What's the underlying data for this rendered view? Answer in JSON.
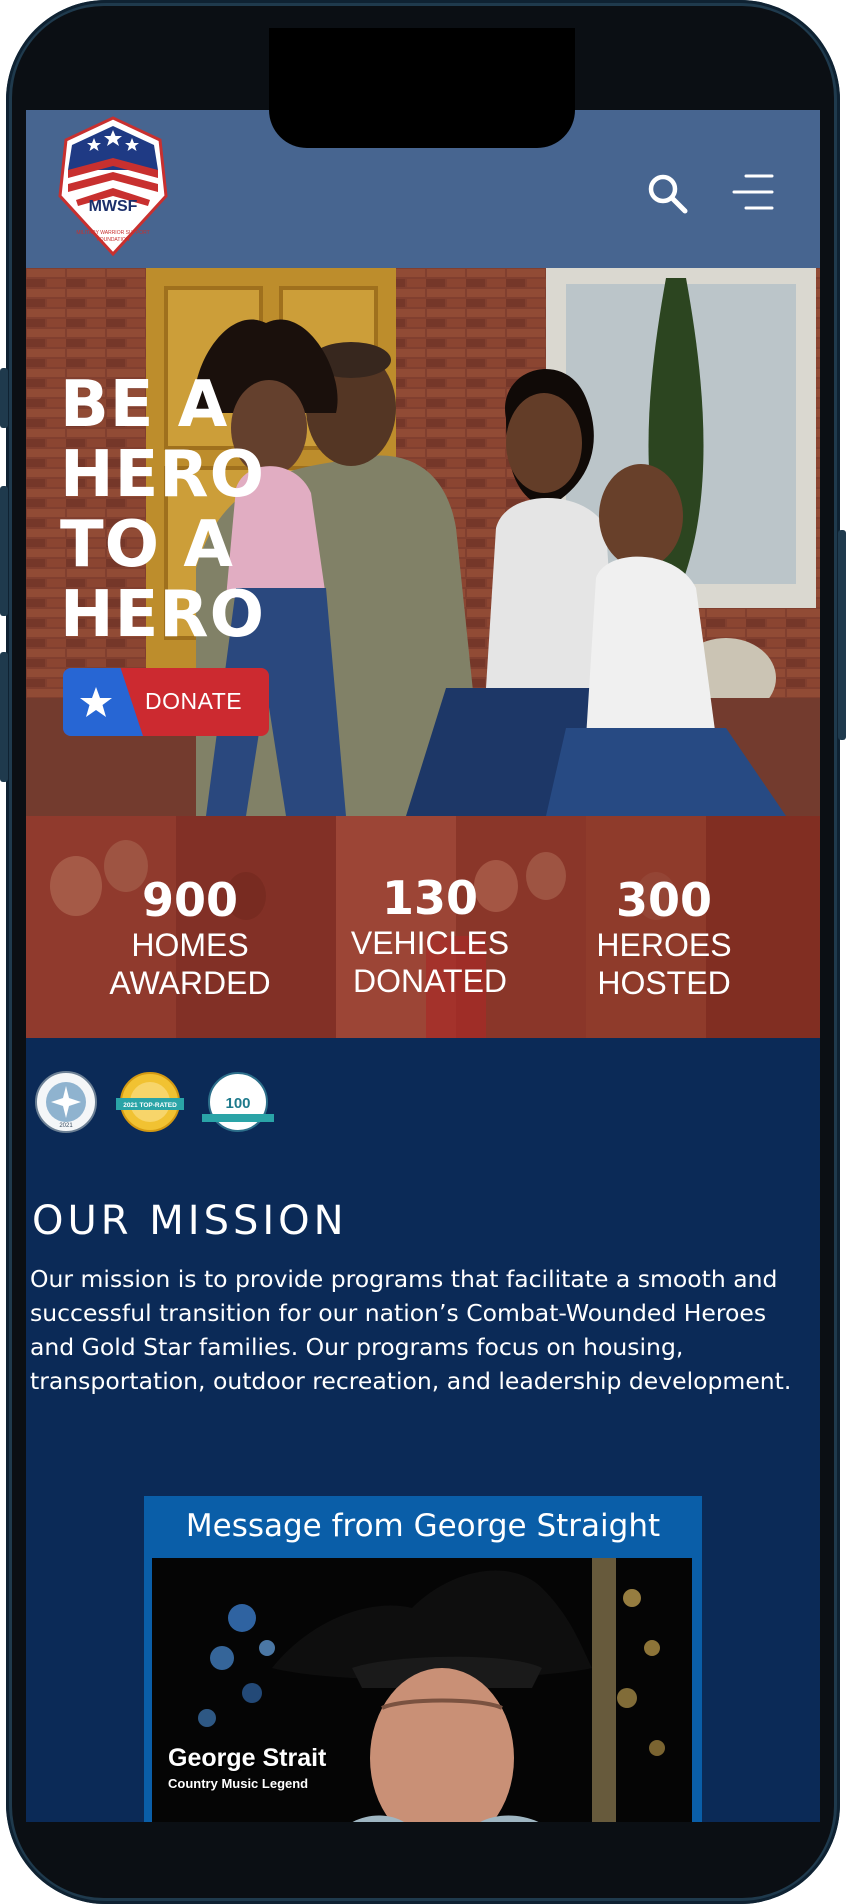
{
  "header": {
    "logo_text": "MWSF",
    "icons": {
      "search": "search-icon",
      "menu": "hamburger-menu-icon"
    }
  },
  "hero": {
    "title_lines": [
      "BE A",
      "HERO",
      "TO A",
      "HERO"
    ],
    "donate_label": "DONATE",
    "donate_icon": "star-icon"
  },
  "stats": [
    {
      "number": "900",
      "label_line1": "HOMES",
      "label_line2": "AWARDED"
    },
    {
      "number": "130",
      "label_line1": "VEHICLES",
      "label_line2": "DONATED"
    },
    {
      "number": "300",
      "label_line1": "HEROES",
      "label_line2": "HOSTED"
    }
  ],
  "badges": {
    "candid": {
      "year": "2021"
    },
    "greatnonprofits": {
      "ribbon": "2021 TOP-RATED"
    },
    "charity_navigator": {
      "score": "100"
    }
  },
  "mission": {
    "heading": "OUR MISSION",
    "text": "Our mission is to provide programs that facilitate a smooth and successful transition for our nation’s Combat-Wounded Heroes and Gold Star families. Our programs focus on housing, transportation, outdoor recreation, and leadership development."
  },
  "video": {
    "title": "Message from George Straight",
    "caption_name": "George Strait",
    "caption_subtitle": "Country Music Legend"
  },
  "colors": {
    "header_bg": "#476590",
    "page_bg": "#0b2a57",
    "donate_red": "#cc2a30",
    "donate_blue": "#2766d4",
    "video_card_bg": "#0a5ea8"
  }
}
